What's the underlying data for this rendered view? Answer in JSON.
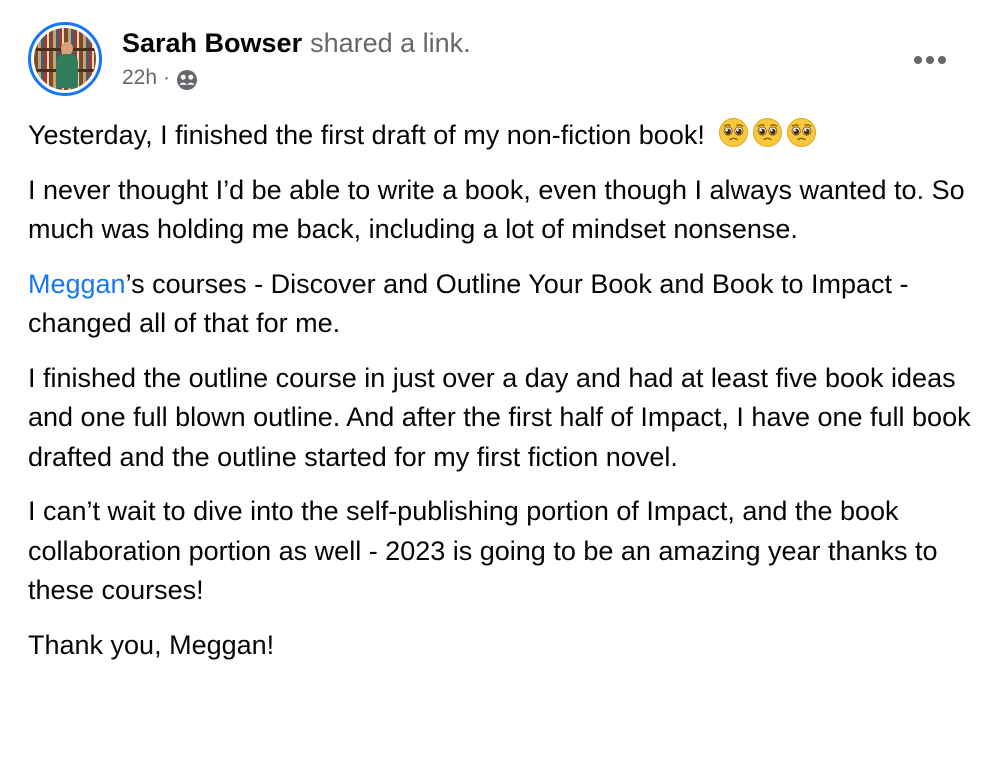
{
  "post": {
    "author": "Sarah Bowser",
    "action": "shared a link.",
    "timestamp": "22h",
    "separator": "·",
    "audience_icon": "friends-icon",
    "more_icon": "more-horizontal-icon",
    "paragraphs": {
      "p1": "Yesterday, I finished the first draft of my non-fiction book!",
      "p1_emojis": [
        "pleading-face-emoji",
        "pleading-face-emoji",
        "pleading-face-emoji"
      ],
      "p2": "I never thought I’d be able to write a book, even though I always wanted to. So much was holding me back, including a lot of mindset nonsense.",
      "p3_link": "Meggan",
      "p3_rest": "’s courses - Discover and Outline Your Book and Book to Impact - changed all of that for me.",
      "p4": "I finished the outline course in just over a day and had at least five book ideas and one full blown outline. And after the first half of Impact, I have one full book drafted and the outline started for my first fiction novel.",
      "p5": "I can’t wait to dive into the self-publishing portion of Impact, and the book collaboration portion as well - 2023 is going to be an amazing year thanks to these courses!",
      "p6": "Thank you, Meggan!"
    }
  },
  "colors": {
    "link": "#1877f2",
    "secondary_text": "#65676b",
    "primary_text": "#050505",
    "avatar_ring": "#1877f2"
  }
}
